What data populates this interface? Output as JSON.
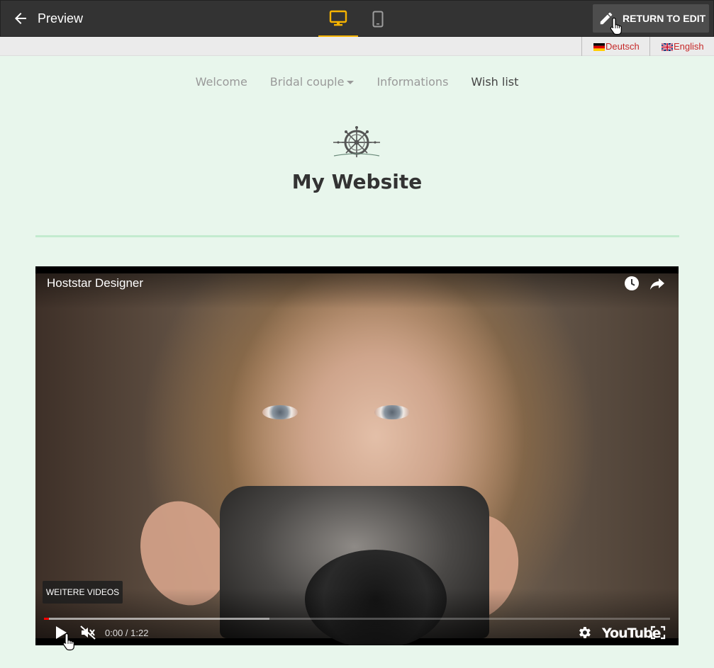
{
  "editor": {
    "title": "Preview",
    "return_label": "RETURN TO EDIT"
  },
  "languages": [
    {
      "label": "Deutsch"
    },
    {
      "label": "English"
    }
  ],
  "nav": {
    "items": [
      {
        "label": "Welcome"
      },
      {
        "label": "Bridal couple"
      },
      {
        "label": "Informations"
      },
      {
        "label": "Wish list"
      }
    ]
  },
  "site": {
    "title": "My Website"
  },
  "video": {
    "title": "Hoststar Designer",
    "more_videos": "WEITERE VIDEOS",
    "time": "0:00 / 1:22",
    "logo": "YouTube",
    "progress_played": 0.008,
    "progress_loaded": 0.36
  },
  "colors": {
    "accent": "#f5b300",
    "topbar": "#333333",
    "page_bg": "#e8f6ec",
    "language_link": "#c62828",
    "progress": "#ff0000"
  },
  "icons": {
    "back": "arrow-left-icon",
    "desktop": "desktop-monitor-icon",
    "mobile": "smartphone-icon",
    "edit": "pencil-icon",
    "watch_later": "clock-icon",
    "share": "share-arrow-icon",
    "play": "play-icon",
    "mute": "volume-muted-icon",
    "settings": "gear-icon",
    "fullscreen": "fullscreen-icon",
    "logo": "ship-wheel-icon"
  }
}
